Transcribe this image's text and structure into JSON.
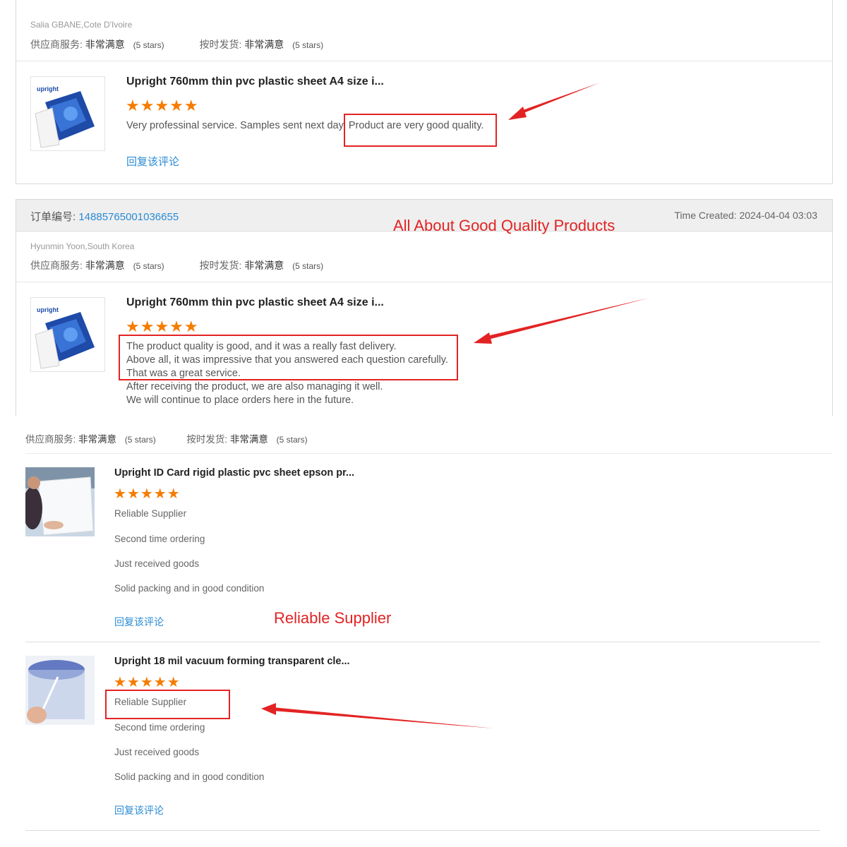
{
  "review1": {
    "buyer": "Salia GBANE,Cote D'Ivoire",
    "supplier_service_label": "供应商服务:",
    "supplier_service_value": "非常满意",
    "supplier_service_stars": "(5 stars)",
    "on_time_label": "按时发货:",
    "on_time_value": "非常满意",
    "on_time_stars": "(5 stars)",
    "product_title": "Upright 760mm thin pvc plastic sheet A4 size i...",
    "stars": "★★★★★",
    "review_text": "Very professinal service. Samples sent next day. Product are very good quality.",
    "reply_link": "回复该评论",
    "thumb_logo": "upright"
  },
  "order2": {
    "order_number_label": "订单编号:",
    "order_number": "14885765001036655",
    "time_created": "Time Created: 2024-04-04 03:03"
  },
  "review2": {
    "buyer": "Hyunmin Yoon,South Korea",
    "supplier_service_label": "供应商服务:",
    "supplier_service_value": "非常满意",
    "supplier_service_stars": "(5 stars)",
    "on_time_label": "按时发货:",
    "on_time_value": "非常满意",
    "on_time_stars": "(5 stars)",
    "product_title": "Upright 760mm thin pvc plastic sheet A4 size i...",
    "stars": "★★★★★",
    "review_lines": [
      "The product quality is good, and it was a really fast delivery.",
      "Above all, it was impressive that you answered each question carefully.",
      "That was a great service.",
      "After receiving the product, we are also managing it well.",
      "We will continue to place orders here in the future."
    ],
    "thumb_logo": "upright"
  },
  "review_group3": {
    "supplier_service_label": "供应商服务:",
    "supplier_service_value": "非常满意",
    "supplier_service_stars": "(5 stars)",
    "on_time_label": "按时发货:",
    "on_time_value": "非常满意",
    "on_time_stars": "(5 stars)"
  },
  "review3": {
    "product_title": "Upright ID Card rigid plastic pvc sheet epson pr...",
    "stars": "★★★★★",
    "review_lines": [
      "Reliable Supplier",
      "Second time ordering",
      "Just received goods",
      "Solid packing and in good condition"
    ],
    "reply_link": "回复该评论"
  },
  "review4": {
    "product_title": "Upright 18 mil vacuum forming transparent cle...",
    "stars": "★★★★★",
    "review_lines": [
      "Reliable Supplier",
      "Second time ordering",
      "Just received goods",
      "Solid packing and in good condition"
    ],
    "reply_link": "回复该评论"
  },
  "annotations": {
    "good_quality": "All About Good Quality Products",
    "reliable_supplier": "Reliable Supplier"
  },
  "colors": {
    "link": "#2a8bd4",
    "stars": "#f57c00",
    "annotation_red": "#e32323"
  }
}
